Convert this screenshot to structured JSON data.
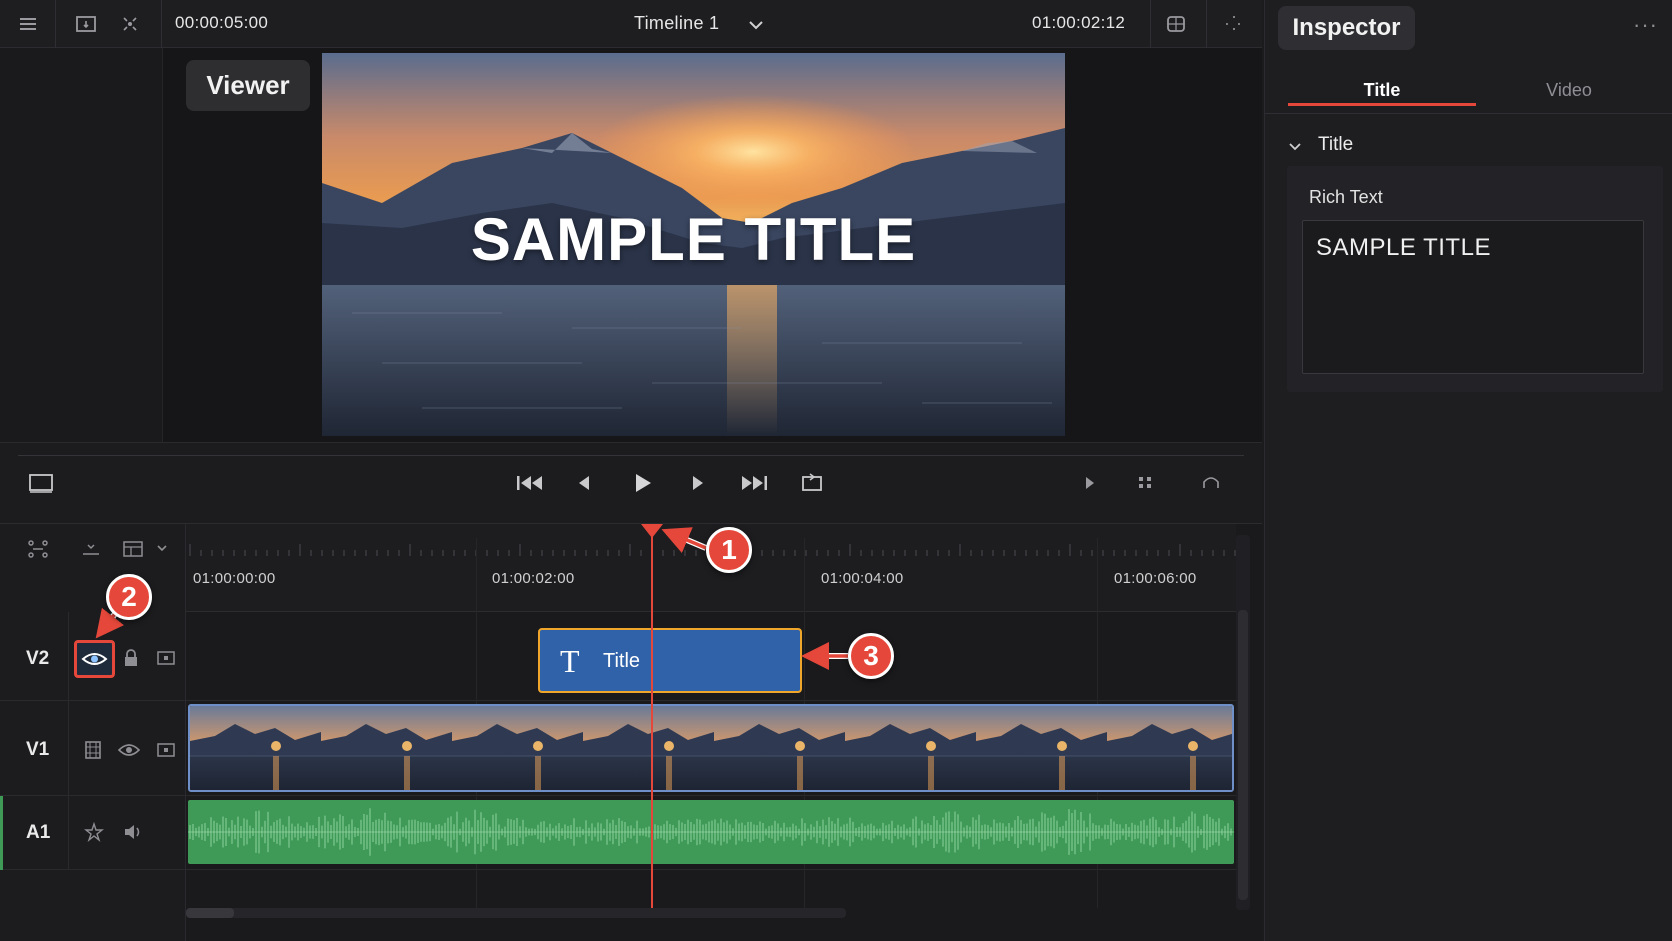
{
  "topbar": {
    "duration": "00:00:05:00",
    "timeline_name": "Timeline 1",
    "timecode": "01:00:02:12",
    "icons": [
      "menu-icon",
      "viewer-layout-icon",
      "transform-icon",
      "chevron-down-icon",
      "safe-area-icon",
      "settings-icon"
    ]
  },
  "viewer": {
    "label": "Viewer",
    "frame_title": "SAMPLE TITLE"
  },
  "transport": {
    "icons": [
      "viewer-mode-icon",
      "skip-to-start-icon",
      "previous-frame-icon",
      "play-icon",
      "next-frame-icon",
      "skip-to-end-icon",
      "loop-icon",
      "play-forward-icon",
      "snap-icon",
      "audio-scrub-icon"
    ]
  },
  "timeline": {
    "ruler_labels": [
      "01:00:00:00",
      "01:00:02:00",
      "01:00:04:00",
      "01:00:06:00"
    ],
    "tracks": [
      {
        "name": "V2"
      },
      {
        "name": "V1"
      },
      {
        "name": "A1"
      }
    ],
    "title_clip_label": "Title",
    "title_clip_icon": "T"
  },
  "inspector": {
    "title": "Inspector",
    "more": "···",
    "tabs": [
      "Title",
      "Video"
    ],
    "active_tab": "Title",
    "section_title": "Title",
    "field_label": "Rich Text",
    "rich_text": "SAMPLE TITLE"
  },
  "annotations": [
    "1",
    "2",
    "3"
  ],
  "colors": {
    "accent_red": "#e5483a",
    "clip_blue": "#2f62a8",
    "clip_outline": "#f0a62a",
    "audio_green": "#3f9a58"
  }
}
